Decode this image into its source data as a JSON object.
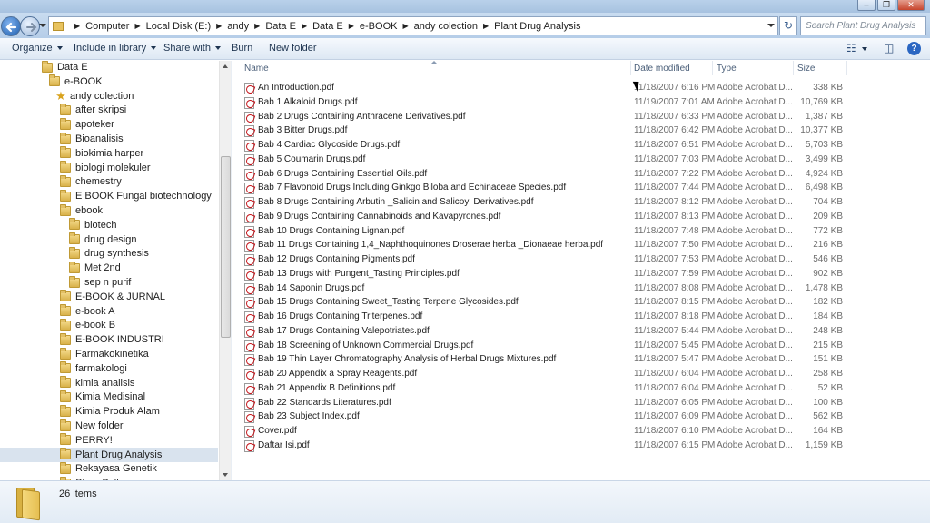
{
  "window": {
    "minimize_glyph": "–",
    "maximize_glyph": "❐",
    "close_glyph": "✕"
  },
  "address_bar": {
    "crumbs": [
      "Computer",
      "Local Disk (E:)",
      "andy",
      "Data E",
      "Data E",
      "e-BOOK",
      "andy colection",
      "Plant Drug Analysis"
    ],
    "search_placeholder": "Search Plant Drug Analysis",
    "refresh_glyph": "↻"
  },
  "toolbar": {
    "organize": "Organize",
    "include_in_library": "Include in library",
    "share_with": "Share with",
    "burn": "Burn",
    "new_folder": "New folder",
    "views_glyph": "☷",
    "preview_glyph": "◫",
    "help_glyph": "?"
  },
  "navigation": {
    "items": [
      {
        "label": "Data E",
        "indent": 0,
        "icon": "folder"
      },
      {
        "label": "e-BOOK",
        "indent": 1,
        "icon": "folder"
      },
      {
        "label": "andy colection",
        "indent": 2,
        "icon": "star"
      },
      {
        "label": "after skripsi",
        "indent": 3,
        "icon": "folder"
      },
      {
        "label": "apoteker",
        "indent": 3,
        "icon": "folder"
      },
      {
        "label": "Bioanalisis",
        "indent": 3,
        "icon": "folder"
      },
      {
        "label": "biokimia harper",
        "indent": 3,
        "icon": "folder"
      },
      {
        "label": "biologi molekuler",
        "indent": 3,
        "icon": "folder"
      },
      {
        "label": "chemestry",
        "indent": 3,
        "icon": "folder"
      },
      {
        "label": "E BOOK Fungal biotechnology",
        "indent": 3,
        "icon": "folder"
      },
      {
        "label": "ebook",
        "indent": 3,
        "icon": "folder"
      },
      {
        "label": "biotech",
        "indent": 4,
        "icon": "folder"
      },
      {
        "label": "drug design",
        "indent": 4,
        "icon": "folder"
      },
      {
        "label": "drug synthesis",
        "indent": 4,
        "icon": "folder"
      },
      {
        "label": "Met 2nd",
        "indent": 4,
        "icon": "folder"
      },
      {
        "label": "sep n purif",
        "indent": 4,
        "icon": "folder"
      },
      {
        "label": "E-BOOK & JURNAL",
        "indent": 3,
        "icon": "folder"
      },
      {
        "label": "e-book A",
        "indent": 3,
        "icon": "folder"
      },
      {
        "label": "e-book B",
        "indent": 3,
        "icon": "folder"
      },
      {
        "label": "E-BOOK INDUSTRI",
        "indent": 3,
        "icon": "folder"
      },
      {
        "label": "Farmakokinetika",
        "indent": 3,
        "icon": "folder"
      },
      {
        "label": "farmakologi",
        "indent": 3,
        "icon": "folder"
      },
      {
        "label": "kimia analisis",
        "indent": 3,
        "icon": "folder"
      },
      {
        "label": "Kimia Medisinal",
        "indent": 3,
        "icon": "folder"
      },
      {
        "label": "Kimia Produk Alam",
        "indent": 3,
        "icon": "folder"
      },
      {
        "label": "New folder",
        "indent": 3,
        "icon": "folder"
      },
      {
        "label": "PERRY!",
        "indent": 3,
        "icon": "folder"
      },
      {
        "label": "Plant Drug Analysis",
        "indent": 3,
        "icon": "folder",
        "selected": true
      },
      {
        "label": "Rekayasa Genetik",
        "indent": 3,
        "icon": "folder"
      },
      {
        "label": "Stem Cell",
        "indent": 3,
        "icon": "folder"
      }
    ]
  },
  "file_list": {
    "columns": {
      "name": "Name",
      "date": "Date modified",
      "type": "Type",
      "size": "Size"
    },
    "files": [
      {
        "name": "An Introduction.pdf",
        "date": "11/18/2007 6:16 PM",
        "type": "Adobe Acrobat D...",
        "size": "338 KB"
      },
      {
        "name": "Bab 1 Alkaloid Drugs.pdf",
        "date": "11/19/2007 7:01 AM",
        "type": "Adobe Acrobat D...",
        "size": "10,769 KB"
      },
      {
        "name": "Bab 2 Drugs Containing Anthracene Derivatives.pdf",
        "date": "11/18/2007 6:33 PM",
        "type": "Adobe Acrobat D...",
        "size": "1,387 KB"
      },
      {
        "name": "Bab 3 Bitter Drugs.pdf",
        "date": "11/18/2007 6:42 PM",
        "type": "Adobe Acrobat D...",
        "size": "10,377 KB"
      },
      {
        "name": "Bab 4 Cardiac Glycoside Drugs.pdf",
        "date": "11/18/2007 6:51 PM",
        "type": "Adobe Acrobat D...",
        "size": "5,703 KB"
      },
      {
        "name": "Bab 5 Coumarin Drugs.pdf",
        "date": "11/18/2007 7:03 PM",
        "type": "Adobe Acrobat D...",
        "size": "3,499 KB"
      },
      {
        "name": "Bab 6 Drugs Containing Essential Oils.pdf",
        "date": "11/18/2007 7:22 PM",
        "type": "Adobe Acrobat D...",
        "size": "4,924 KB"
      },
      {
        "name": "Bab 7 Flavonoid Drugs Including Ginkgo Biloba and Echinaceae Species.pdf",
        "date": "11/18/2007 7:44 PM",
        "type": "Adobe Acrobat D...",
        "size": "6,498 KB"
      },
      {
        "name": "Bab 8 Drugs Containing Arbutin _Salicin and Salicoyi Derivatives.pdf",
        "date": "11/18/2007 8:12 PM",
        "type": "Adobe Acrobat D...",
        "size": "704 KB"
      },
      {
        "name": "Bab 9 Drugs Containing Cannabinoids and Kavapyrones.pdf",
        "date": "11/18/2007 8:13 PM",
        "type": "Adobe Acrobat D...",
        "size": "209 KB"
      },
      {
        "name": "Bab 10 Drugs Containing Lignan.pdf",
        "date": "11/18/2007 7:48 PM",
        "type": "Adobe Acrobat D...",
        "size": "772 KB"
      },
      {
        "name": "Bab 11 Drugs Containing 1,4_Naphthoquinones Droserae herba _Dionaeae herba.pdf",
        "date": "11/18/2007 7:50 PM",
        "type": "Adobe Acrobat D...",
        "size": "216 KB"
      },
      {
        "name": "Bab 12 Drugs Containing Pigments.pdf",
        "date": "11/18/2007 7:53 PM",
        "type": "Adobe Acrobat D...",
        "size": "546 KB"
      },
      {
        "name": "Bab 13 Drugs with Pungent_Tasting Principles.pdf",
        "date": "11/18/2007 7:59 PM",
        "type": "Adobe Acrobat D...",
        "size": "902 KB"
      },
      {
        "name": "Bab 14 Saponin Drugs.pdf",
        "date": "11/18/2007 8:08 PM",
        "type": "Adobe Acrobat D...",
        "size": "1,478 KB"
      },
      {
        "name": "Bab 15 Drugs Containing Sweet_Tasting Terpene Glycosides.pdf",
        "date": "11/18/2007 8:15 PM",
        "type": "Adobe Acrobat D...",
        "size": "182 KB"
      },
      {
        "name": "Bab 16 Drugs Containing Triterpenes.pdf",
        "date": "11/18/2007 8:18 PM",
        "type": "Adobe Acrobat D...",
        "size": "184 KB"
      },
      {
        "name": "Bab 17 Drugs Containing Valepotriates.pdf",
        "date": "11/18/2007 5:44 PM",
        "type": "Adobe Acrobat D...",
        "size": "248 KB"
      },
      {
        "name": "Bab 18 Screening of Unknown Commercial Drugs.pdf",
        "date": "11/18/2007 5:45 PM",
        "type": "Adobe Acrobat D...",
        "size": "215 KB"
      },
      {
        "name": "Bab 19 Thin Layer Chromatography Analysis of Herbal Drugs Mixtures.pdf",
        "date": "11/18/2007 5:47 PM",
        "type": "Adobe Acrobat D...",
        "size": "151 KB"
      },
      {
        "name": "Bab 20 Appendix a Spray Reagents.pdf",
        "date": "11/18/2007 6:04 PM",
        "type": "Adobe Acrobat D...",
        "size": "258 KB"
      },
      {
        "name": "Bab 21 Appendix B Definitions.pdf",
        "date": "11/18/2007 6:04 PM",
        "type": "Adobe Acrobat D...",
        "size": "52 KB"
      },
      {
        "name": "Bab 22 Standards Literatures.pdf",
        "date": "11/18/2007 6:05 PM",
        "type": "Adobe Acrobat D...",
        "size": "100 KB"
      },
      {
        "name": "Bab 23 Subject Index.pdf",
        "date": "11/18/2007 6:09 PM",
        "type": "Adobe Acrobat D...",
        "size": "562 KB"
      },
      {
        "name": "Cover.pdf",
        "date": "11/18/2007 6:10 PM",
        "type": "Adobe Acrobat D...",
        "size": "164 KB"
      },
      {
        "name": "Daftar Isi.pdf",
        "date": "11/18/2007 6:15 PM",
        "type": "Adobe Acrobat D...",
        "size": "1,159 KB"
      }
    ]
  },
  "status": {
    "item_count": "26 items"
  }
}
